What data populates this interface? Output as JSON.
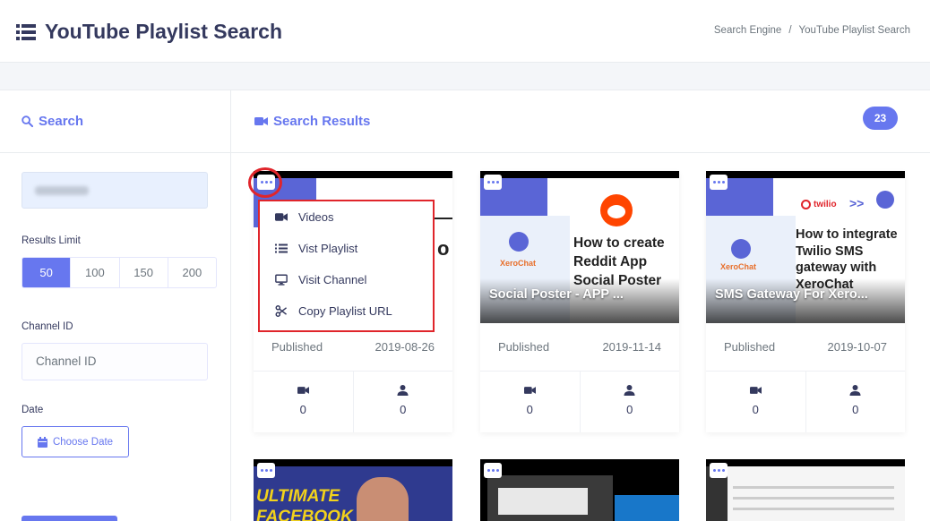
{
  "header": {
    "title": "YouTube Playlist Search",
    "breadcrumb": [
      "Search Engine",
      "YouTube Playlist Search"
    ]
  },
  "search_panel": {
    "title": "Search",
    "results_limit_label": "Results Limit",
    "limits": [
      "50",
      "100",
      "150",
      "200"
    ],
    "active_limit": "50",
    "channel_id_label": "Channel ID",
    "channel_id_placeholder": "Channel ID",
    "date_label": "Date",
    "date_button": "Choose Date"
  },
  "results": {
    "title": "Search Results",
    "count": "23",
    "cards": [
      {
        "title": "",
        "published_label": "Published",
        "date": "2019-08-26",
        "videos": "0",
        "subscribers": "0"
      },
      {
        "title": "Social Poster - APP ...",
        "published_label": "Published",
        "date": "2019-11-14",
        "videos": "0",
        "subscribers": "0",
        "thumb_text": "How to create Reddit App Social Poster",
        "brand": "XeroChat"
      },
      {
        "title": "SMS Gateway For Xero...",
        "published_label": "Published",
        "date": "2019-10-07",
        "videos": "0",
        "subscribers": "0",
        "thumb_text": "How to integrate Twilio SMS gateway with XeroChat",
        "brand": "XeroChat",
        "partner": "twilio"
      }
    ],
    "bottom_thumb_text": "ULTIMATE FACEBOOK"
  },
  "dropdown": {
    "items": [
      "Videos",
      "Vist Playlist",
      "Visit Channel",
      "Copy Playlist URL"
    ]
  },
  "colors": {
    "accent": "#6777ef",
    "highlight": "#e0252b"
  }
}
